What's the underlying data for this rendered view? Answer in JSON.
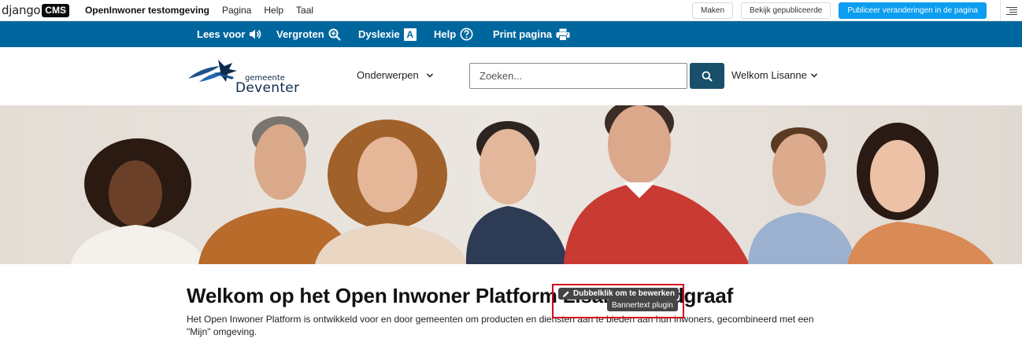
{
  "cms_toolbar": {
    "logo_django": "django",
    "logo_cms": "CMS",
    "site_name": "OpenInwoner testomgeving",
    "menu": [
      "Pagina",
      "Help",
      "Taal"
    ],
    "buttons": {
      "create": "Maken",
      "view_published": "Bekijk gepubliceerde",
      "publish": "Publiceer veranderingen in de pagina"
    },
    "structure_icon": "structure-icon"
  },
  "accessibility_bar": {
    "read_aloud": "Lees voor",
    "zoom": "Vergroten",
    "dyslexia": "Dyslexie",
    "dyslexia_glyph": "A",
    "help": "Help",
    "print": "Print pagina"
  },
  "header": {
    "logo_small": "gemeente",
    "logo_large": "Deventer",
    "nav_topics": "Onderwerpen",
    "search_placeholder": "Zoeken...",
    "welcome": "Welkom Lisanne"
  },
  "banner": {
    "subject": "group of seven smiling people"
  },
  "content": {
    "title": "Welkom op het Open Inwoner Platform Lisanne Hodgraaf",
    "intro": "Het Open Inwoner Platform is ontwikkeld voor en door gemeenten om producten en diensten aan te bieden aan hun inwoners, gecombineerd met een \"Mijn\" omgeving."
  },
  "edit_tooltip": {
    "line1": "Dubbelklik om te bewerken",
    "line2": "Bannertext plugin"
  },
  "colors": {
    "accent_blue": "#00679e",
    "search_button": "#184f6b",
    "publish_button": "#0b9df0",
    "highlight_red": "#d0021b"
  }
}
